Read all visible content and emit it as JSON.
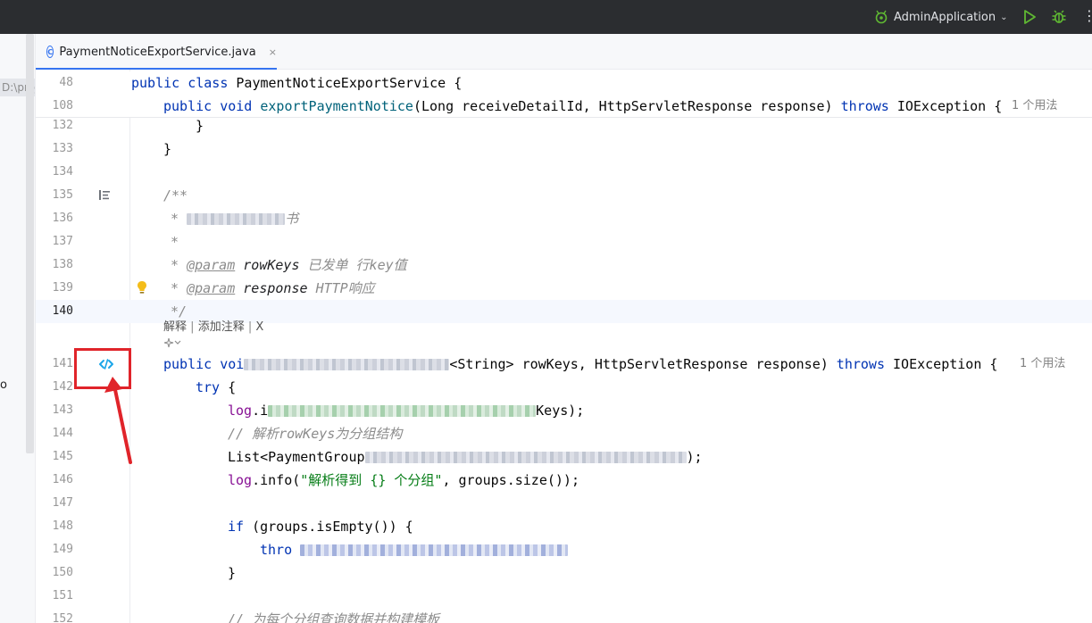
{
  "titlebar": {
    "run_config": "AdminApplication",
    "more": "⋮"
  },
  "project_panel": {
    "path_fragment": "D:\\proje",
    "fragment_o": "o"
  },
  "tab": {
    "file_name": "PaymentNoticeExportService.java",
    "icon_letter": "C",
    "close": "×"
  },
  "sticky_lines": [
    {
      "num": "48",
      "code": "public class PaymentNoticeExportService {"
    },
    {
      "num": "108",
      "code": "public void exportPaymentNotice(Long receiveDetailId, HttpServletResponse response) throws IOException {",
      "usages": "1 个用法"
    }
  ],
  "lines": [
    {
      "num": "132",
      "text": "}"
    },
    {
      "num": "133",
      "text": "}"
    },
    {
      "num": "134"
    },
    {
      "num": "135",
      "text": "/**"
    },
    {
      "num": "136",
      "text": "*",
      "tail": "书"
    },
    {
      "num": "137",
      "text": "*"
    },
    {
      "num": "138",
      "text": "*",
      "tag": "@param",
      "param": "rowKeys",
      "desc": "已发单 行key值"
    },
    {
      "num": "139",
      "text": "*",
      "tag": "@param",
      "param": "response",
      "desc": "HTTP响应"
    },
    {
      "num": "140",
      "text": "*/"
    },
    {
      "num": "141",
      "kw1": "public",
      "kw2": "voi",
      "mid": "<String> rowKeys, HttpServletResponse response)",
      "kw3": "throws",
      "tail": "IOException {",
      "usages": "1 个用法"
    },
    {
      "num": "142",
      "kw": "try",
      "text": "{"
    },
    {
      "num": "143",
      "sf": "log",
      "text": ".i",
      "tail": "Keys);"
    },
    {
      "num": "144",
      "comment": "// 解析rowKeys为分组结构"
    },
    {
      "num": "145",
      "text": "List<PaymentGroup",
      "tail": ");"
    },
    {
      "num": "146",
      "sf": "log",
      "text": ".info(",
      "str": "\"解析得到 {} 个分组\"",
      "tail": ", groups.size());"
    },
    {
      "num": "147"
    },
    {
      "num": "148",
      "kw": "if",
      "text": "(groups.isEmpty()) {"
    },
    {
      "num": "149",
      "kw": "thro"
    },
    {
      "num": "150",
      "text": "}"
    },
    {
      "num": "151"
    },
    {
      "num": "152",
      "comment": "// 为每个分组查询数据并构建模板"
    }
  ],
  "inlay_actions": {
    "explain": "解释",
    "add_comment": "添加注释",
    "close": "X",
    "sep": "|"
  },
  "colors": {
    "keyword": "#0033b3",
    "method": "#00627a",
    "comment": "#8c8c8c",
    "string": "#067d17",
    "static_field": "#871094",
    "annotation_box": "#e0242a",
    "tab_accent": "#3574f0"
  },
  "icons": [
    "run-icon",
    "debug-icon",
    "c-class-icon",
    "structure-icon",
    "bulb-icon",
    "code-link-icon",
    "ai-sparkle-icon"
  ]
}
